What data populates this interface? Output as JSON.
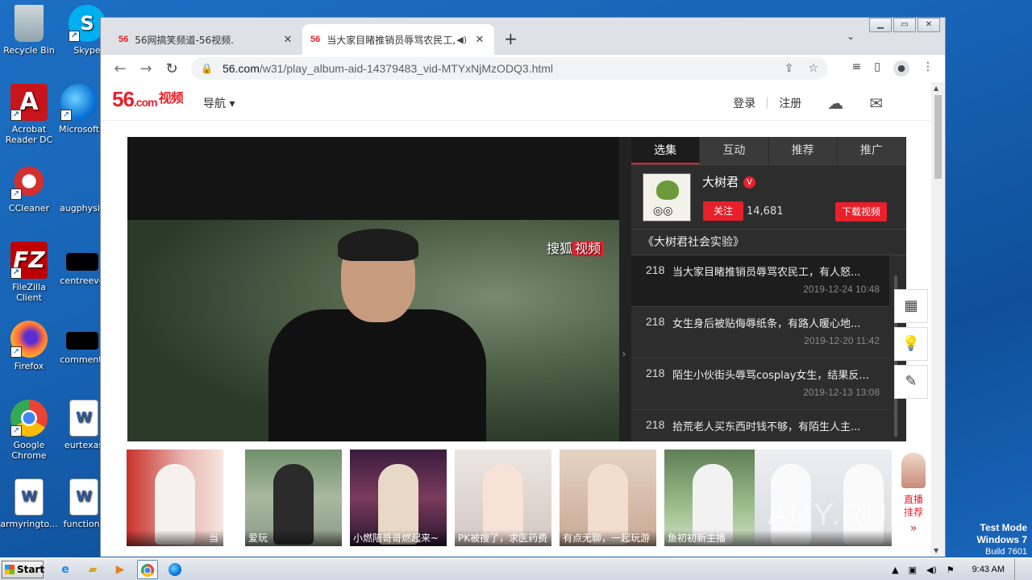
{
  "desktop": {
    "icons": [
      {
        "label": "Recycle Bin",
        "kind": "recycle-bin-icon"
      },
      {
        "label": "Skype",
        "kind": "skype-icon"
      },
      {
        "label": "Acrobat Reader DC",
        "kind": "acrobat-icon"
      },
      {
        "label": "Microsoft",
        "kind": "edge-icon"
      },
      {
        "label": "CCleaner",
        "kind": "ccleaner-icon"
      },
      {
        "label": "augphysic",
        "kind": "file-icon"
      },
      {
        "label": "FileZilla Client",
        "kind": "filezilla-icon"
      },
      {
        "label": "centreeve",
        "kind": "file-icon"
      },
      {
        "label": "Firefox",
        "kind": "firefox-icon"
      },
      {
        "label": "commentl",
        "kind": "file-icon"
      },
      {
        "label": "Google Chrome",
        "kind": "chrome-icon"
      },
      {
        "label": "eurtexas",
        "kind": "word-doc-icon"
      },
      {
        "label": "armyringto...",
        "kind": "word-doc-icon"
      },
      {
        "label": "functions",
        "kind": "word-doc-icon"
      }
    ],
    "watermark": "ANY.RUN",
    "test_mode": {
      "line1": "Test Mode",
      "line2": "Windows 7",
      "line3": "Build 7601"
    }
  },
  "browser": {
    "tabs": [
      {
        "favicon": "56",
        "title": "56网搞笑频道-56视频.",
        "active": false
      },
      {
        "favicon": "56",
        "title": "当大家目睹推销员辱骂农民工,",
        "active": true
      }
    ],
    "new_tab": "+",
    "address": {
      "domain": "56.com",
      "path": "/w31/play_album-aid-14379483_vid-MTYxNjMzODQ3.html"
    }
  },
  "site": {
    "logo_num": "56",
    "logo_dom": ".com",
    "logo_cn": "视频",
    "nav_label": "导航 ▾",
    "login": "登录",
    "register": "注册",
    "video_watermark_a": "搜狐",
    "video_watermark_b": "视频",
    "panel": {
      "tabs": [
        "选集",
        "互动",
        "推荐",
        "推广"
      ],
      "owner_name": "大树君",
      "verified": "V",
      "follow_label": "关注",
      "fans": "14,681",
      "download_label": "下载视频",
      "album_title": "《大树君社会实验》",
      "episodes": [
        {
          "num": "218",
          "title": "当大家目睹推销员辱骂农民工，有人怒...",
          "date": "2019-12-24 10:48",
          "current": true
        },
        {
          "num": "218",
          "title": "女生身后被贴侮辱纸条，有路人暖心地...",
          "date": "2019-12-20 11:42",
          "current": false
        },
        {
          "num": "218",
          "title": "陌生小伙街头辱骂cosplay女生，结果反...",
          "date": "2019-12-13 13:08",
          "current": false
        },
        {
          "num": "218",
          "title": "拾荒老人买东西时钱不够，有陌生人主...",
          "date": "",
          "current": false
        }
      ]
    },
    "thumbnails": [
      {
        "label": "当"
      },
      {
        "label": "爱玩"
      },
      {
        "label": "小燃陪哥哥燃起来~"
      },
      {
        "label": "PK被搜了，求医药费"
      },
      {
        "label": "有点无聊，一起玩游"
      },
      {
        "label": "鱼初初新主播"
      },
      {
        "label": ""
      }
    ],
    "live_label_1": "直播",
    "live_label_2": "推荐",
    "live_arrow": "»"
  },
  "taskbar": {
    "start_label": "Start",
    "clock": "9:43 AM"
  }
}
